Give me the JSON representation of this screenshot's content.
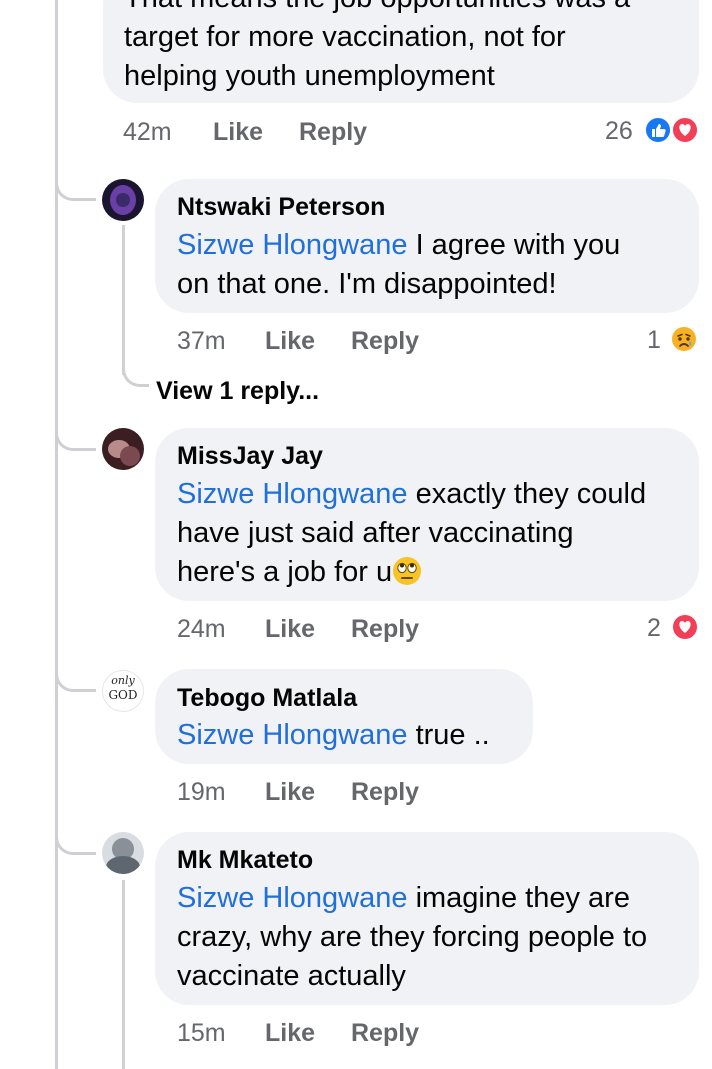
{
  "comments": [
    {
      "id": "top",
      "text_line0": "That means the job opportunities was a",
      "text_line1": "target for more vaccination, not for",
      "text_line2": "helping youth unemployment",
      "time": "42m",
      "like": "Like",
      "reply": "Reply",
      "reaction_count": "26",
      "reactions": [
        "like-icon",
        "love-icon"
      ]
    },
    {
      "id": "ntswaki",
      "author": "Ntswaki Peterson",
      "mention": "Sizwe Hlongwane",
      "text_line0": " I agree with you",
      "text_line1": "on that one. I'm disappointed!",
      "time": "37m",
      "like": "Like",
      "reply": "Reply",
      "reaction_count": "1",
      "reactions": [
        "sad-icon"
      ],
      "view_replies": "View 1 reply..."
    },
    {
      "id": "missjay",
      "author": "MissJay Jay",
      "mention": "Sizwe Hlongwane",
      "text_line0": " exactly they could",
      "text_line1": "have just said after vaccinating",
      "text_line2": "here's a job for u",
      "emoji": "eye-roll-emoji",
      "time": "24m",
      "like": "Like",
      "reply": "Reply",
      "reaction_count": "2",
      "reactions": [
        "love-icon"
      ]
    },
    {
      "id": "tebogo",
      "author": "Tebogo Matlala",
      "avatar_text_top": "only",
      "avatar_text_bottom": "GOD",
      "mention": "Sizwe Hlongwane",
      "text_line0": " true ..",
      "time": "19m",
      "like": "Like",
      "reply": "Reply"
    },
    {
      "id": "mk",
      "author": "Mk Mkateto",
      "mention": "Sizwe Hlongwane",
      "text_line0": " imagine they are",
      "text_line1": "crazy, why are they forcing people to",
      "text_line2": "vaccinate actually",
      "time": "15m",
      "like": "Like",
      "reply": "Reply"
    }
  ],
  "colors": {
    "mention": "#216fdb",
    "bubble": "#f0f2f5",
    "meta": "#65676b",
    "like_reaction": "#1877f2",
    "love_reaction": "#f33e58"
  }
}
